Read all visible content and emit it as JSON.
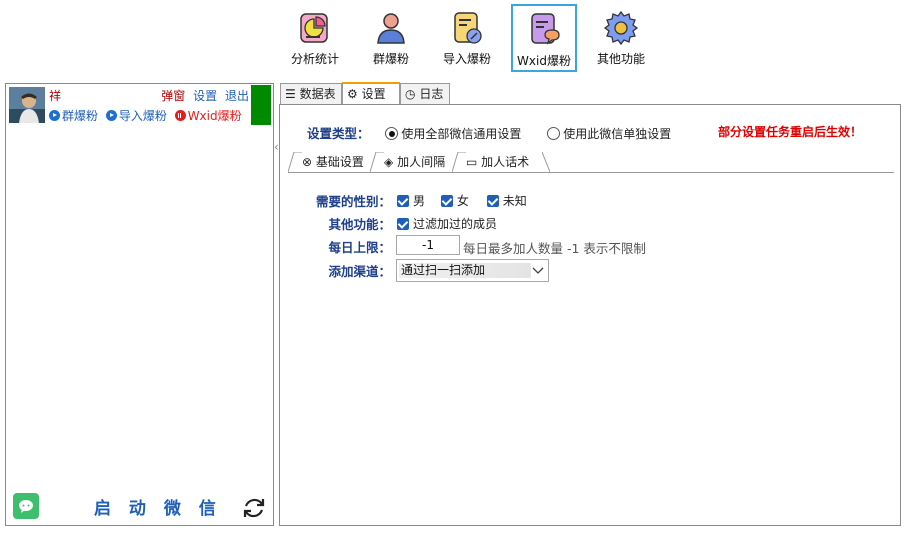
{
  "toolbar": {
    "items": [
      {
        "label": "分析统计",
        "icon": "pie-chart-icon"
      },
      {
        "label": "群爆粉",
        "icon": "user-group-icon"
      },
      {
        "label": "导入爆粉",
        "icon": "import-note-icon"
      },
      {
        "label": "Wxid爆粉",
        "icon": "chat-note-icon"
      },
      {
        "label": "其他功能",
        "icon": "gear-icon"
      }
    ],
    "active_index": 3
  },
  "account": {
    "name": "祥",
    "popup_label": "弹窗",
    "settings_label": "设置",
    "logout_label": "退出",
    "actions": [
      {
        "label": "群爆粉"
      },
      {
        "label": "导入爆粉"
      },
      {
        "label": "Wxid爆粉"
      }
    ],
    "status_color": "#008a00"
  },
  "left_footer": {
    "start_label": "启 动 微 信"
  },
  "tabs": [
    {
      "label": "数据表",
      "icon": "list-icon"
    },
    {
      "label": "设置",
      "icon": "gear-icon"
    },
    {
      "label": "日志",
      "icon": "clock-icon"
    }
  ],
  "active_tab": 1,
  "settings": {
    "type_label": "设置类型：",
    "option_global": "使用全部微信通用设置",
    "option_single": "使用此微信单独设置",
    "selected": "global",
    "warning": "部分设置任务重启后生效！",
    "subtabs": [
      {
        "label": "基础设置",
        "icon": "settings-small-icon"
      },
      {
        "label": "加人间隔",
        "icon": "interval-icon"
      },
      {
        "label": "加人话术",
        "icon": "message-icon"
      }
    ],
    "gender_label": "需要的性别：",
    "gender_options": [
      {
        "label": "男",
        "checked": true
      },
      {
        "label": "女",
        "checked": true
      },
      {
        "label": "未知",
        "checked": true
      }
    ],
    "other_label": "其他功能：",
    "filter_added": {
      "label": "过滤加过的成员",
      "checked": true
    },
    "daily_label": "每日上限：",
    "daily_value": "-1",
    "daily_hint": "每日最多加人数量  -1 表示不限制",
    "channel_label": "添加渠道：",
    "channel_value": "通过扫一扫添加"
  },
  "colors": {
    "accent_blue": "#1f5fb8",
    "label_blue": "#1f3f8a",
    "warning_red": "#e00000",
    "active_border": "#3aa5e0",
    "tab_active_top": "#f0a000"
  }
}
